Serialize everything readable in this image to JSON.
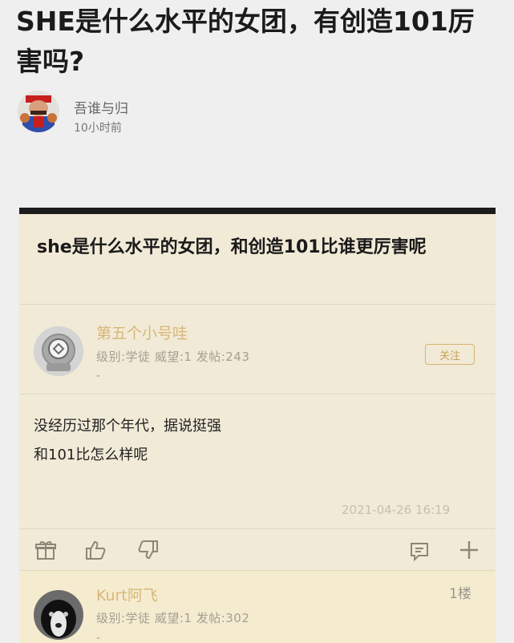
{
  "article": {
    "title": "SHE是什么水平的女团，有创造101厉害吗?",
    "author": "吾谁与归",
    "time": "10小时前"
  },
  "screenshot": {
    "post_title": "she是什么水平的女团，和创造101比谁更厉害呢",
    "op": {
      "username": "第五个小号哇",
      "meta": "级别:学徒  威望:1  发帖:243",
      "dash": "-",
      "follow_label": "关注"
    },
    "content_lines": [
      "没经历过那个年代，据说挺强",
      "和101比怎么样呢"
    ],
    "timestamp": "2021-04-26 16:19",
    "actions": [
      "gift-icon",
      "thumbs-up-icon",
      "thumbs-down-icon",
      "comment-icon",
      "plus-icon"
    ],
    "reply": {
      "username": "Kurt阿飞",
      "meta": "级别:学徒  威望:1  发帖:302",
      "floor": "1楼",
      "dash": "-"
    }
  }
}
